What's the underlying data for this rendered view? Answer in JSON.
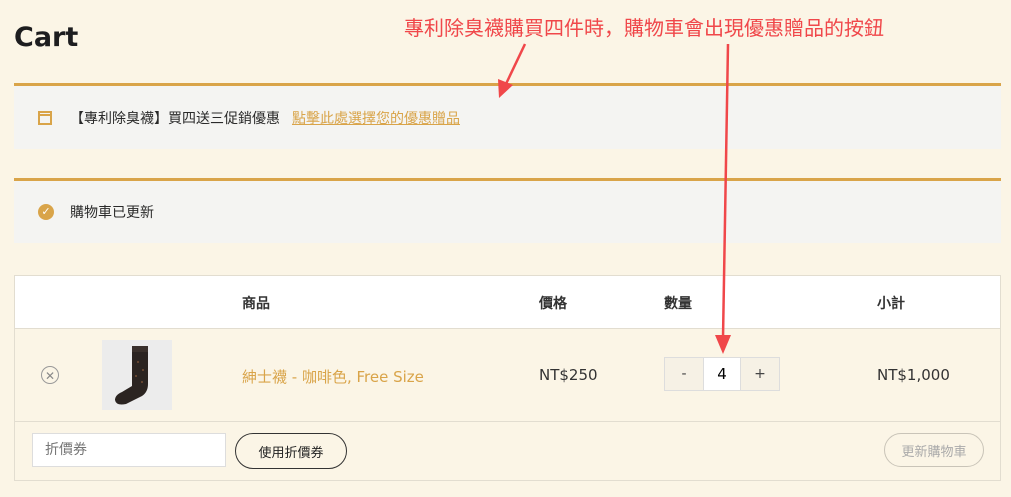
{
  "page": {
    "title": "Cart"
  },
  "annotation": {
    "text": "專利除臭襪購買四件時，購物車會出現優惠贈品的按鈕",
    "color": "#f0474a"
  },
  "notices": {
    "promo": {
      "text": "【專利除臭襪】買四送三促銷優惠",
      "link": "點擊此處選擇您的優惠贈品"
    },
    "updated": {
      "text": "購物車已更新"
    }
  },
  "table": {
    "headers": {
      "product": "商品",
      "price": "價格",
      "quantity": "數量",
      "subtotal": "小計"
    },
    "rows": [
      {
        "name": "紳士襪 - 咖啡色, Free Size",
        "price": "NT$250",
        "quantity": "4",
        "subtotal": "NT$1,000"
      }
    ]
  },
  "coupon": {
    "placeholder": "折價券",
    "apply_label": "使用折價券"
  },
  "update_label": "更新購物車",
  "qty_controls": {
    "minus": "-",
    "plus": "+"
  },
  "colors": {
    "accent": "#d9a449",
    "background": "#fbf5e6",
    "annotation": "#f0474a"
  },
  "icons": {
    "promo_notice": "calendar-icon",
    "updated_notice": "check-circle-icon",
    "remove": "close-circle-icon"
  }
}
